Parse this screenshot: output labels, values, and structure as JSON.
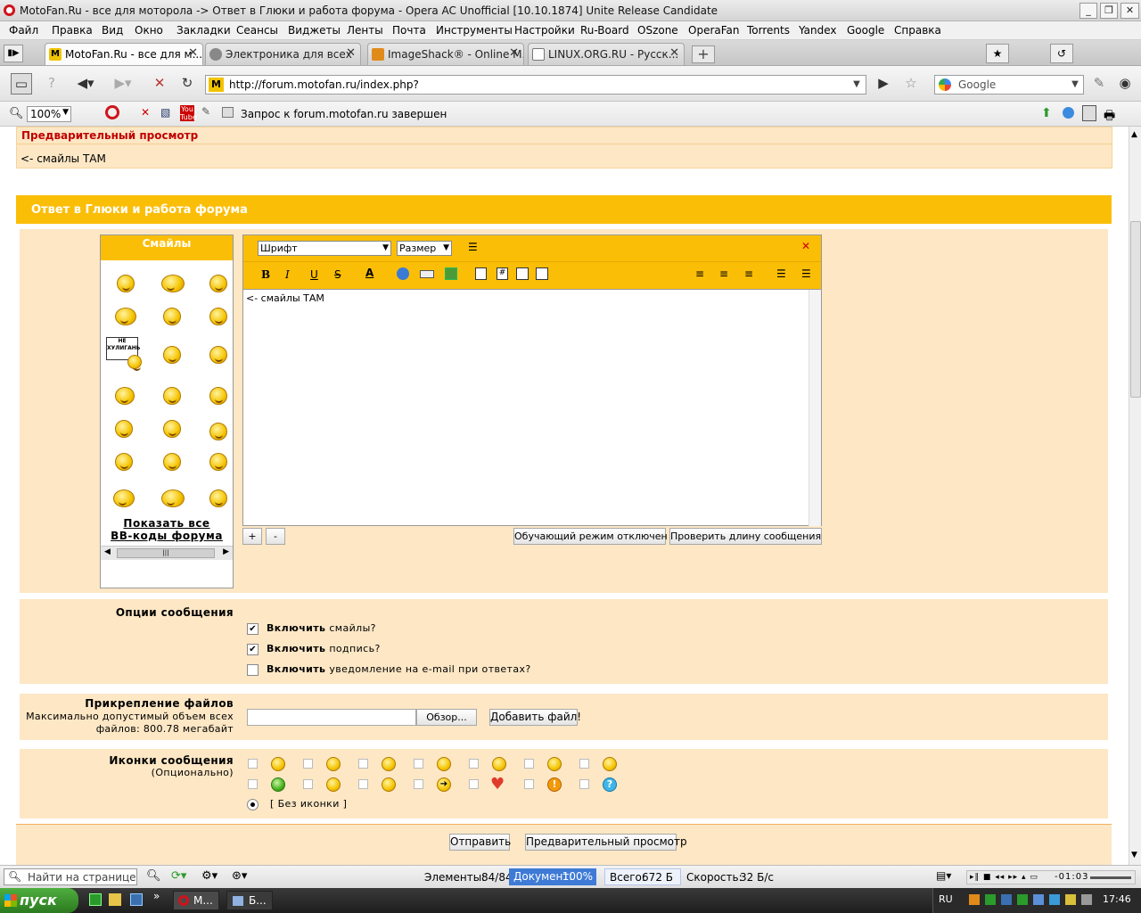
{
  "window": {
    "title": "MotoFan.Ru - все для моторола -> Ответ в Глюки и работа форума - Opera AC Unofficial [10.10.1874] Unite Release Candidate"
  },
  "menu": [
    "Файл",
    "Правка",
    "Вид",
    "Окно",
    "Закладки",
    "Сеансы",
    "Виджеты",
    "Ленты",
    "Почта",
    "Инструменты",
    "Настройки",
    "Ru-Board",
    "OSzone",
    "OperaFan",
    "Torrents",
    "Yandex",
    "Google",
    "Справка"
  ],
  "tabs": [
    {
      "label": "MotoFan.Ru - все для м...",
      "icon": "motofan-favicon"
    },
    {
      "label": "Электроника для всех",
      "icon": "gear-favicon"
    },
    {
      "label": "ImageShack® - Online M...",
      "icon": "imageshack-favicon"
    },
    {
      "label": "LINUX.ORG.RU - Русск...",
      "icon": "linux-favicon"
    }
  ],
  "address": {
    "url": "http://forum.motofan.ru/index.php?",
    "search_placeholder": "Google"
  },
  "status_top": {
    "zoom": "100%",
    "message": "Запрос к forum.motofan.ru завершен"
  },
  "preview": {
    "title": "Предварительный просмотр",
    "text": "<- смайлы ТАМ"
  },
  "reply": {
    "title": "Ответ в Глюки и работа форума"
  },
  "smileys": {
    "title": "Смайлы",
    "show_all": "Показать все",
    "bbcodes": "BB-коды форума",
    "sign": "НЕ ХУЛИГАНЬ"
  },
  "editor": {
    "font_label": "Шрифт",
    "size_label": "Размер",
    "bold": "B",
    "italic": "I",
    "underline": "U",
    "strike": "S",
    "content": "<- смайлы ТАМ",
    "plus": "+",
    "minus": "-",
    "tutorial_btn": "Обучающий режим отключен",
    "check_length_btn": "Проверить длину сообщения"
  },
  "options": {
    "label": "Опции сообщения",
    "items": [
      {
        "bold": "Включить",
        "rest": "смайлы?",
        "checked": true
      },
      {
        "bold": "Включить",
        "rest": "подпись?",
        "checked": true
      },
      {
        "bold": "Включить",
        "rest": "уведомление на e-mail при ответах?",
        "checked": false
      }
    ]
  },
  "attach": {
    "label": "Прикрепление файлов",
    "desc1": "Максимально допустимый объем всех",
    "desc2": "файлов: 800.78 мегабайт",
    "browse": "Обзор...",
    "add": "Добавить файл!"
  },
  "icons": {
    "label": "Иконки сообщения",
    "sub": "(Опционально)",
    "none": "[ Без иконки ]"
  },
  "actions": {
    "submit": "Отправить",
    "preview": "Предварительный просмотр"
  },
  "statusbar": {
    "find_placeholder": "Найти на странице",
    "elements_label": "Элементы:",
    "elements_value": "84/84",
    "document_label": "Документ:",
    "document_value": "100%",
    "total_label": "Всего:",
    "total_value": "672 Б",
    "speed_label": "Скорость:",
    "speed_value": "32 Б/с",
    "media_time": "-01:03"
  },
  "taskbar": {
    "start": "пуск",
    "task1": "М...",
    "task2": "Б...",
    "lang": "RU",
    "clock": "17:46"
  },
  "colors": {
    "accent": "#fbbe07",
    "panel": "#fde7c5",
    "preview_title": "#c00000"
  }
}
